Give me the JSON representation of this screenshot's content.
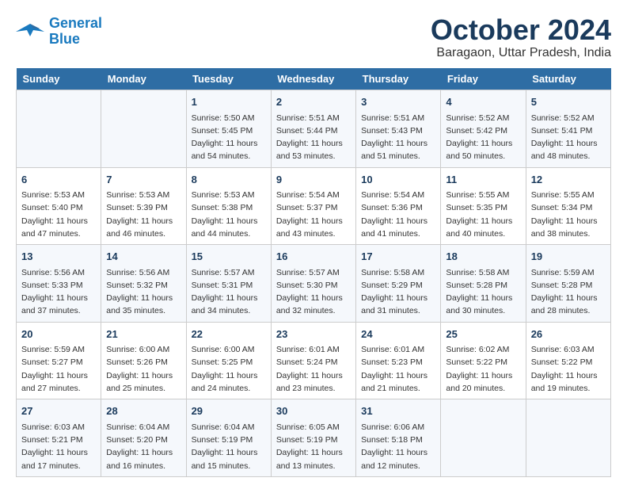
{
  "logo": {
    "line1": "General",
    "line2": "Blue"
  },
  "title": "October 2024",
  "location": "Baragaon, Uttar Pradesh, India",
  "days_of_week": [
    "Sunday",
    "Monday",
    "Tuesday",
    "Wednesday",
    "Thursday",
    "Friday",
    "Saturday"
  ],
  "weeks": [
    [
      {
        "day": "",
        "info": ""
      },
      {
        "day": "",
        "info": ""
      },
      {
        "day": "1",
        "info": "Sunrise: 5:50 AM\nSunset: 5:45 PM\nDaylight: 11 hours\nand 54 minutes."
      },
      {
        "day": "2",
        "info": "Sunrise: 5:51 AM\nSunset: 5:44 PM\nDaylight: 11 hours\nand 53 minutes."
      },
      {
        "day": "3",
        "info": "Sunrise: 5:51 AM\nSunset: 5:43 PM\nDaylight: 11 hours\nand 51 minutes."
      },
      {
        "day": "4",
        "info": "Sunrise: 5:52 AM\nSunset: 5:42 PM\nDaylight: 11 hours\nand 50 minutes."
      },
      {
        "day": "5",
        "info": "Sunrise: 5:52 AM\nSunset: 5:41 PM\nDaylight: 11 hours\nand 48 minutes."
      }
    ],
    [
      {
        "day": "6",
        "info": "Sunrise: 5:53 AM\nSunset: 5:40 PM\nDaylight: 11 hours\nand 47 minutes."
      },
      {
        "day": "7",
        "info": "Sunrise: 5:53 AM\nSunset: 5:39 PM\nDaylight: 11 hours\nand 46 minutes."
      },
      {
        "day": "8",
        "info": "Sunrise: 5:53 AM\nSunset: 5:38 PM\nDaylight: 11 hours\nand 44 minutes."
      },
      {
        "day": "9",
        "info": "Sunrise: 5:54 AM\nSunset: 5:37 PM\nDaylight: 11 hours\nand 43 minutes."
      },
      {
        "day": "10",
        "info": "Sunrise: 5:54 AM\nSunset: 5:36 PM\nDaylight: 11 hours\nand 41 minutes."
      },
      {
        "day": "11",
        "info": "Sunrise: 5:55 AM\nSunset: 5:35 PM\nDaylight: 11 hours\nand 40 minutes."
      },
      {
        "day": "12",
        "info": "Sunrise: 5:55 AM\nSunset: 5:34 PM\nDaylight: 11 hours\nand 38 minutes."
      }
    ],
    [
      {
        "day": "13",
        "info": "Sunrise: 5:56 AM\nSunset: 5:33 PM\nDaylight: 11 hours\nand 37 minutes."
      },
      {
        "day": "14",
        "info": "Sunrise: 5:56 AM\nSunset: 5:32 PM\nDaylight: 11 hours\nand 35 minutes."
      },
      {
        "day": "15",
        "info": "Sunrise: 5:57 AM\nSunset: 5:31 PM\nDaylight: 11 hours\nand 34 minutes."
      },
      {
        "day": "16",
        "info": "Sunrise: 5:57 AM\nSunset: 5:30 PM\nDaylight: 11 hours\nand 32 minutes."
      },
      {
        "day": "17",
        "info": "Sunrise: 5:58 AM\nSunset: 5:29 PM\nDaylight: 11 hours\nand 31 minutes."
      },
      {
        "day": "18",
        "info": "Sunrise: 5:58 AM\nSunset: 5:28 PM\nDaylight: 11 hours\nand 30 minutes."
      },
      {
        "day": "19",
        "info": "Sunrise: 5:59 AM\nSunset: 5:28 PM\nDaylight: 11 hours\nand 28 minutes."
      }
    ],
    [
      {
        "day": "20",
        "info": "Sunrise: 5:59 AM\nSunset: 5:27 PM\nDaylight: 11 hours\nand 27 minutes."
      },
      {
        "day": "21",
        "info": "Sunrise: 6:00 AM\nSunset: 5:26 PM\nDaylight: 11 hours\nand 25 minutes."
      },
      {
        "day": "22",
        "info": "Sunrise: 6:00 AM\nSunset: 5:25 PM\nDaylight: 11 hours\nand 24 minutes."
      },
      {
        "day": "23",
        "info": "Sunrise: 6:01 AM\nSunset: 5:24 PM\nDaylight: 11 hours\nand 23 minutes."
      },
      {
        "day": "24",
        "info": "Sunrise: 6:01 AM\nSunset: 5:23 PM\nDaylight: 11 hours\nand 21 minutes."
      },
      {
        "day": "25",
        "info": "Sunrise: 6:02 AM\nSunset: 5:22 PM\nDaylight: 11 hours\nand 20 minutes."
      },
      {
        "day": "26",
        "info": "Sunrise: 6:03 AM\nSunset: 5:22 PM\nDaylight: 11 hours\nand 19 minutes."
      }
    ],
    [
      {
        "day": "27",
        "info": "Sunrise: 6:03 AM\nSunset: 5:21 PM\nDaylight: 11 hours\nand 17 minutes."
      },
      {
        "day": "28",
        "info": "Sunrise: 6:04 AM\nSunset: 5:20 PM\nDaylight: 11 hours\nand 16 minutes."
      },
      {
        "day": "29",
        "info": "Sunrise: 6:04 AM\nSunset: 5:19 PM\nDaylight: 11 hours\nand 15 minutes."
      },
      {
        "day": "30",
        "info": "Sunrise: 6:05 AM\nSunset: 5:19 PM\nDaylight: 11 hours\nand 13 minutes."
      },
      {
        "day": "31",
        "info": "Sunrise: 6:06 AM\nSunset: 5:18 PM\nDaylight: 11 hours\nand 12 minutes."
      },
      {
        "day": "",
        "info": ""
      },
      {
        "day": "",
        "info": ""
      }
    ]
  ]
}
